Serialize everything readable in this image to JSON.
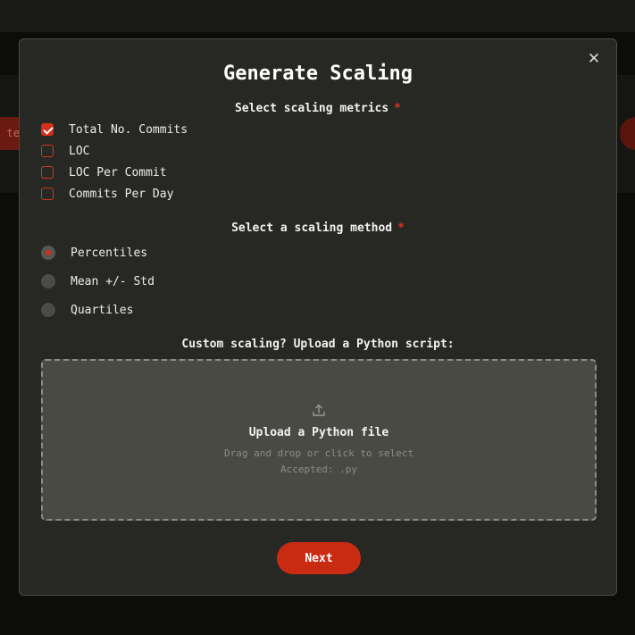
{
  "background": {
    "left_pill_text": "te"
  },
  "modal": {
    "title": "Generate Scaling",
    "close_symbol": "✕",
    "metrics": {
      "label": "Select scaling metrics",
      "required_mark": "*",
      "options": [
        {
          "label": "Total No. Commits",
          "checked": true
        },
        {
          "label": "LOC",
          "checked": false
        },
        {
          "label": "LOC Per Commit",
          "checked": false
        },
        {
          "label": "Commits Per Day",
          "checked": false
        }
      ]
    },
    "method": {
      "label": "Select a scaling method",
      "required_mark": "*",
      "options": [
        {
          "label": "Percentiles",
          "selected": true
        },
        {
          "label": "Mean +/- Std",
          "selected": false
        },
        {
          "label": "Quartiles",
          "selected": false
        }
      ]
    },
    "custom": {
      "label": "Custom scaling? Upload a Python script:"
    },
    "upload": {
      "icon": "upload-icon",
      "title": "Upload a Python file",
      "hint": "Drag and drop or click to select",
      "accepted": "Accepted: .py"
    },
    "next_label": "Next"
  },
  "colors": {
    "accent": "#d2301a",
    "modal_bg": "#272724",
    "dropzone_bg": "#4a4a45"
  }
}
